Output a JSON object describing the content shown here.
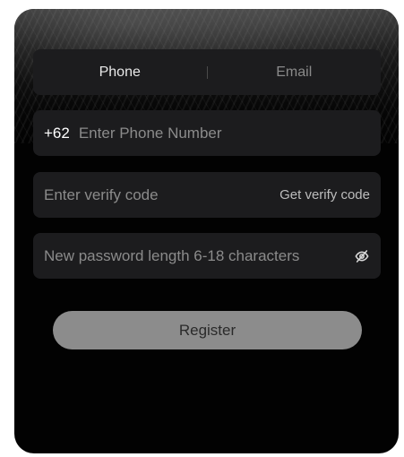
{
  "tabs": {
    "phone_label": "Phone",
    "email_label": "Email",
    "active": "Phone"
  },
  "phone_field": {
    "country_code": "+62",
    "placeholder": "Enter Phone Number",
    "value": ""
  },
  "code_field": {
    "placeholder": "Enter verify code",
    "value": "",
    "get_code_label": "Get verify code"
  },
  "password_field": {
    "placeholder": "New password length 6-18 characters",
    "value": "",
    "toggle_icon": "eye-off-icon"
  },
  "register_button": {
    "label": "Register"
  },
  "colors": {
    "card_background": "#020202",
    "field_background": "#1c1c1e",
    "button_background": "#8c8c8c",
    "button_text": "#2a2a2a",
    "placeholder_text": "#8b8b8b"
  }
}
